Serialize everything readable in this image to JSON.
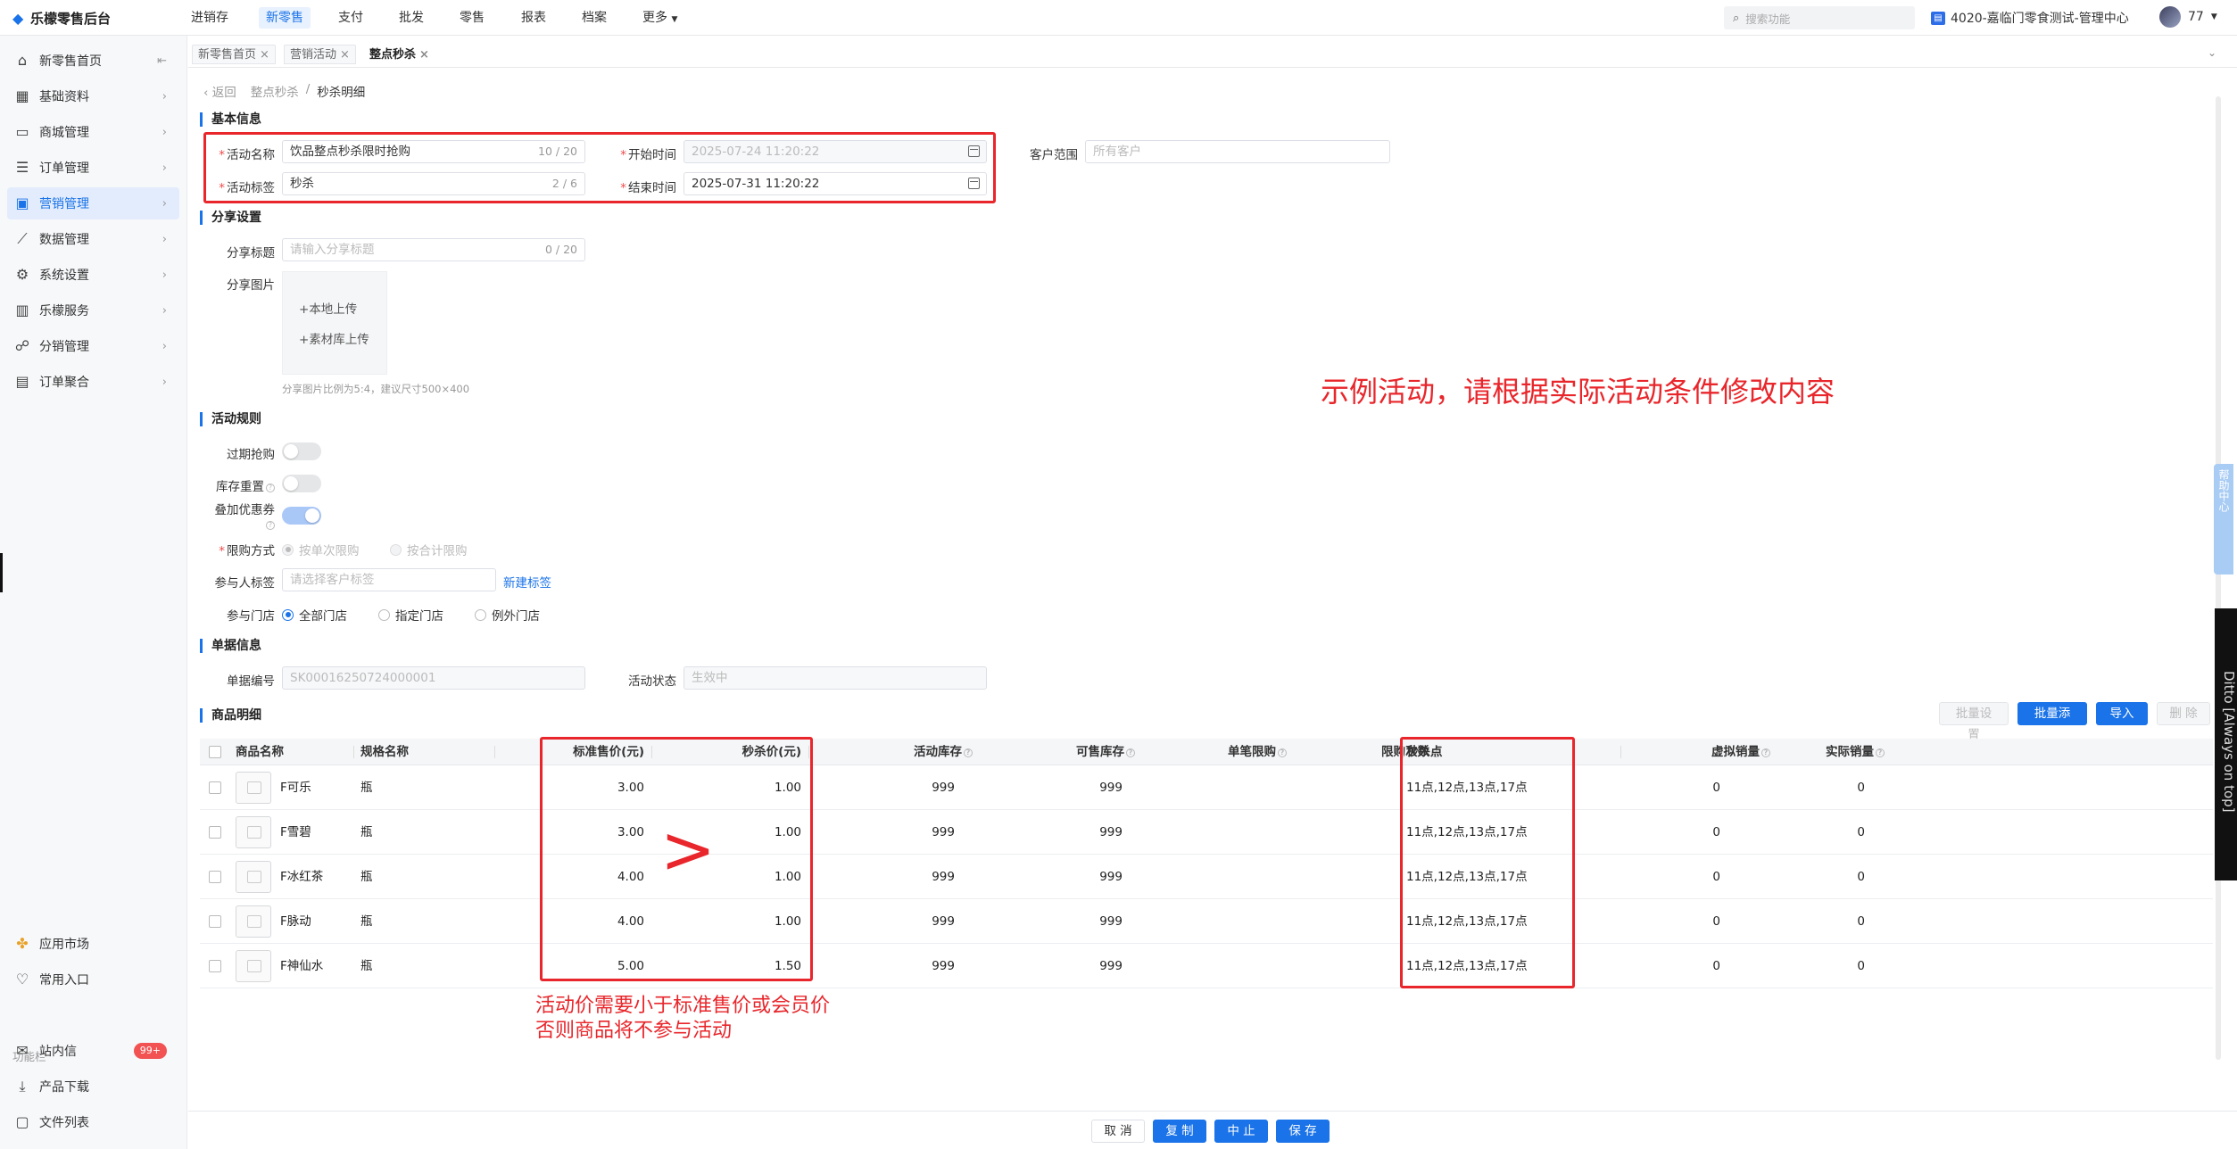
{
  "app": {
    "title": "乐檬零售后台"
  },
  "topnav": [
    "进销存",
    "新零售",
    "支付",
    "批发",
    "零售",
    "报表",
    "档案",
    "更多"
  ],
  "search": {
    "placeholder": "搜索功能"
  },
  "store": "4020-嘉临门零食测试-管理中心",
  "user": "77",
  "sidebar": {
    "items": [
      "新零售首页",
      "基础资料",
      "商城管理",
      "订单管理",
      "营销管理",
      "数据管理",
      "系统设置",
      "乐檬服务",
      "分销管理",
      "订单聚合"
    ],
    "bottom": [
      "应用市场",
      "常用入口"
    ],
    "func_label": "功能栏",
    "func": [
      "站内信",
      "产品下载",
      "文件列表"
    ],
    "badge": "99+"
  },
  "tabs": [
    "新零售首页",
    "营销活动",
    "整点秒杀"
  ],
  "breadcrumb": {
    "back": "返回",
    "parent": "整点秒杀",
    "sep": "/",
    "current": "秒杀明细"
  },
  "basic": {
    "title": "基本信息",
    "name_label": "活动名称",
    "name": "饮品整点秒杀限时抢购",
    "name_count": "10 / 20",
    "tag_label": "活动标签",
    "tag": "秒杀",
    "tag_count": "2 / 6",
    "start_label": "开始时间",
    "start": "2025-07-24 11:20:22",
    "end_label": "结束时间",
    "end": "2025-07-31 11:20:22",
    "range_label": "客户范围",
    "range_ph": "所有客户"
  },
  "share": {
    "title": "分享设置",
    "title_label": "分享标题",
    "title_ph": "请输入分享标题",
    "title_count": "0 / 20",
    "image_label": "分享图片",
    "upload_local": "本地上传",
    "upload_lib": "素材库上传",
    "hint": "分享图片比例为5:4，建议尺寸500×400"
  },
  "rules": {
    "title": "活动规则",
    "expired": "过期抢购",
    "reset": "库存重置",
    "coupon": "叠加优惠券",
    "limit_label": "限购方式",
    "limit_a": "按单次限购",
    "limit_b": "按合计限购",
    "tag_label": "参与人标签",
    "tag_ph": "请选择客户标签",
    "new_tag": "新建标签",
    "store_label": "参与门店",
    "store_all": "全部门店",
    "store_some": "指定门店",
    "store_except": "例外门店"
  },
  "doc": {
    "title": "单据信息",
    "no_label": "单据编号",
    "no": "SK00016250724000001",
    "status_label": "活动状态",
    "status": "生效中"
  },
  "goods": {
    "title": "商品明细",
    "btn_batch_set": "批量设置",
    "btn_batch_add": "批量添加",
    "btn_import": "导入",
    "btn_delete": "删 除",
    "headers": [
      "商品名称",
      "规格名称",
      "标准售价(元)",
      "秒杀价(元)",
      "活动库存",
      "可售库存",
      "单笔限购",
      "限购次数",
      "秒杀点",
      "虚拟销量",
      "实际销量"
    ],
    "rows": [
      {
        "name": "F可乐",
        "spec": "瓶",
        "std": "3.00",
        "sec": "1.00",
        "act": "999",
        "avail": "999",
        "points": "11点,12点,13点,17点",
        "virt": "0",
        "real": "0"
      },
      {
        "name": "F雪碧",
        "spec": "瓶",
        "std": "3.00",
        "sec": "1.00",
        "act": "999",
        "avail": "999",
        "points": "11点,12点,13点,17点",
        "virt": "0",
        "real": "0"
      },
      {
        "name": "F冰红茶",
        "spec": "瓶",
        "std": "4.00",
        "sec": "1.00",
        "act": "999",
        "avail": "999",
        "points": "11点,12点,13点,17点",
        "virt": "0",
        "real": "0"
      },
      {
        "name": "F脉动",
        "spec": "瓶",
        "std": "4.00",
        "sec": "1.00",
        "act": "999",
        "avail": "999",
        "points": "11点,12点,13点,17点",
        "virt": "0",
        "real": "0"
      },
      {
        "name": "F神仙水",
        "spec": "瓶",
        "std": "5.00",
        "sec": "1.50",
        "act": "999",
        "avail": "999",
        "points": "11点,12点,13点,17点",
        "virt": "0",
        "real": "0"
      }
    ]
  },
  "annotations": {
    "example": "示例活动，请根据实际活动条件修改内容",
    "gt": ">",
    "rule_line1": "活动价需要小于标准售价或会员价",
    "rule_line2": "否则商品将不参与活动"
  },
  "footer": {
    "cancel": "取 消",
    "copy": "复 制",
    "stop": "中 止",
    "save": "保 存"
  },
  "help": "帮助中心",
  "ditto": "Ditto [Always on top]",
  "colors": {
    "accent": "#1a73e8",
    "annotation": "#e8262b"
  }
}
